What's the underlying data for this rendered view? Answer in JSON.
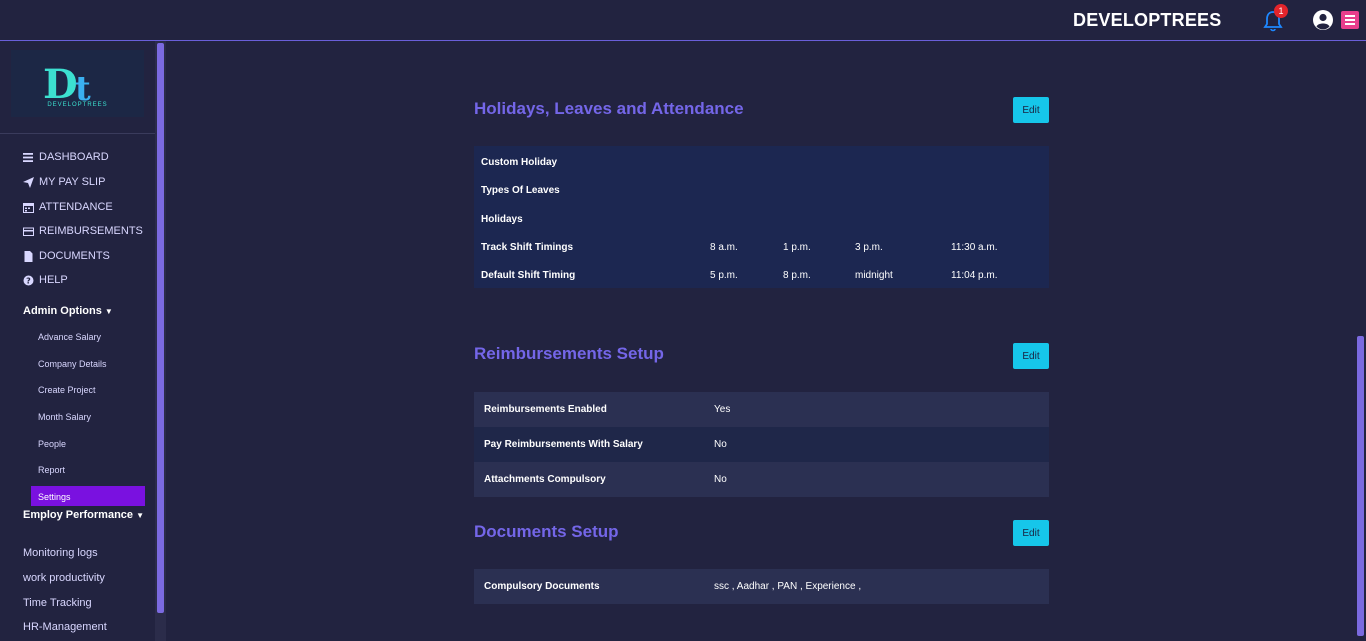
{
  "header": {
    "brand": "DEVELOPTREES",
    "notification_count": "1"
  },
  "sidebar": {
    "logo_text": "DEVELOPTREES",
    "nav": [
      {
        "label": "DASHBOARD",
        "icon": "bars-icon"
      },
      {
        "label": "MY PAY SLIP",
        "icon": "paper-plane-icon"
      },
      {
        "label": "ATTENDANCE",
        "icon": "calendar-icon"
      },
      {
        "label": "REIMBURSEMENTS",
        "icon": "credit-card-icon"
      },
      {
        "label": "DOCUMENTS",
        "icon": "file-icon"
      },
      {
        "label": "HELP",
        "icon": "question-circle-icon"
      }
    ],
    "admin_options_label": "Admin Options",
    "admin_items": [
      "Advance Salary",
      "Company Details",
      "Create Project",
      "Month Salary",
      "People",
      "Report",
      "Settings"
    ],
    "employ_performance_label": "Employ Performance",
    "extra_items": [
      "Monitoring logs",
      "work productivity",
      "Time Tracking",
      "HR-Management"
    ]
  },
  "holidays": {
    "title": "Holidays, Leaves and Attendance",
    "edit_label": "Edit",
    "rows": [
      {
        "label": "Custom Holiday",
        "values": []
      },
      {
        "label": "Types Of Leaves",
        "values": []
      },
      {
        "label": "Holidays",
        "values": []
      },
      {
        "label": "Track Shift Timings",
        "values": [
          "8 a.m.",
          "1 p.m.",
          "3 p.m.",
          "11:30 a.m."
        ]
      },
      {
        "label": "Default Shift Timing",
        "values": [
          "5 p.m.",
          "8 p.m.",
          "midnight",
          "11:04 p.m."
        ]
      }
    ]
  },
  "reimbursements": {
    "title": "Reimbursements Setup",
    "edit_label": "Edit",
    "rows": [
      {
        "label": "Reimbursements Enabled",
        "value": "Yes"
      },
      {
        "label": "Pay Reimbursements With Salary",
        "value": "No"
      },
      {
        "label": "Attachments Compulsory",
        "value": "No"
      }
    ]
  },
  "documents": {
    "title": "Documents Setup",
    "edit_label": "Edit",
    "rows": [
      {
        "label": "Compulsory Documents",
        "value": "ssc , Aadhar , PAN , Experience ,"
      }
    ]
  },
  "colors": {
    "background": "#222340",
    "accent": "#7466e8",
    "edit_button": "#16c6ea",
    "active_item": "#7a11e0",
    "table_dark": "#1c2751",
    "table_light": "#2b3052"
  }
}
